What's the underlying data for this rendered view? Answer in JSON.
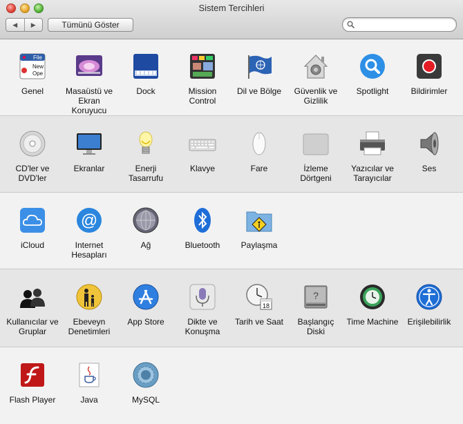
{
  "window": {
    "title": "Sistem Tercihleri",
    "back": "◀",
    "forward": "▶",
    "show_all": "Tümünü Göster",
    "search_value": "",
    "search_placeholder": ""
  },
  "sections": [
    [
      {
        "label": "Genel",
        "icon": "general-file-icon"
      },
      {
        "label": "Masaüstü ve Ekran Koruyucu",
        "icon": "desktop-screensaver-icon"
      },
      {
        "label": "Dock",
        "icon": "dock-icon"
      },
      {
        "label": "Mission Control",
        "icon": "mission-control-icon"
      },
      {
        "label": "Dil ve Bölge",
        "icon": "un-flag-icon"
      },
      {
        "label": "Güvenlik ve Gizlilik",
        "icon": "house-lock-icon"
      },
      {
        "label": "Spotlight",
        "icon": "spotlight-magnifier-icon"
      },
      {
        "label": "Bildirimler",
        "icon": "notifications-record-icon"
      }
    ],
    [
      {
        "label": "CD'ler ve DVD'ler",
        "icon": "cd-disc-icon"
      },
      {
        "label": "Ekranlar",
        "icon": "display-monitor-icon"
      },
      {
        "label": "Enerji Tasarrufu",
        "icon": "lightbulb-icon"
      },
      {
        "label": "Klavye",
        "icon": "keyboard-icon"
      },
      {
        "label": "Fare",
        "icon": "mouse-icon"
      },
      {
        "label": "İzleme Dörtgeni",
        "icon": "trackpad-icon"
      },
      {
        "label": "Yazıcılar ve Tarayıcılar",
        "icon": "printer-icon"
      },
      {
        "label": "Ses",
        "icon": "speaker-icon"
      }
    ],
    [
      {
        "label": "iCloud",
        "icon": "icloud-icon"
      },
      {
        "label": "Internet Hesapları",
        "icon": "at-sign-icon"
      },
      {
        "label": "Ağ",
        "icon": "network-globe-icon"
      },
      {
        "label": "Bluetooth",
        "icon": "bluetooth-icon"
      },
      {
        "label": "Paylaşma",
        "icon": "sharing-folder-icon"
      }
    ],
    [
      {
        "label": "Kullanıcılar ve Gruplar",
        "icon": "users-silhouette-icon"
      },
      {
        "label": "Ebeveyn Denetimleri",
        "icon": "parental-controls-icon"
      },
      {
        "label": "App Store",
        "icon": "app-store-icon"
      },
      {
        "label": "Dikte ve Konuşma",
        "icon": "microphone-icon"
      },
      {
        "label": "Tarih ve Saat",
        "icon": "clock-calendar-icon"
      },
      {
        "label": "Başlangıç Diski",
        "icon": "startup-disk-icon"
      },
      {
        "label": "Time Machine",
        "icon": "time-machine-icon"
      },
      {
        "label": "Erişilebilirlik",
        "icon": "accessibility-icon"
      }
    ],
    [
      {
        "label": "Flash Player",
        "icon": "flash-player-icon"
      },
      {
        "label": "Java",
        "icon": "java-cup-icon"
      },
      {
        "label": "MySQL",
        "icon": "mysql-icon"
      }
    ]
  ],
  "misc": {
    "calendar_day": "18",
    "file_label": "File",
    "file_line1": "New",
    "file_line2": "Ope"
  }
}
